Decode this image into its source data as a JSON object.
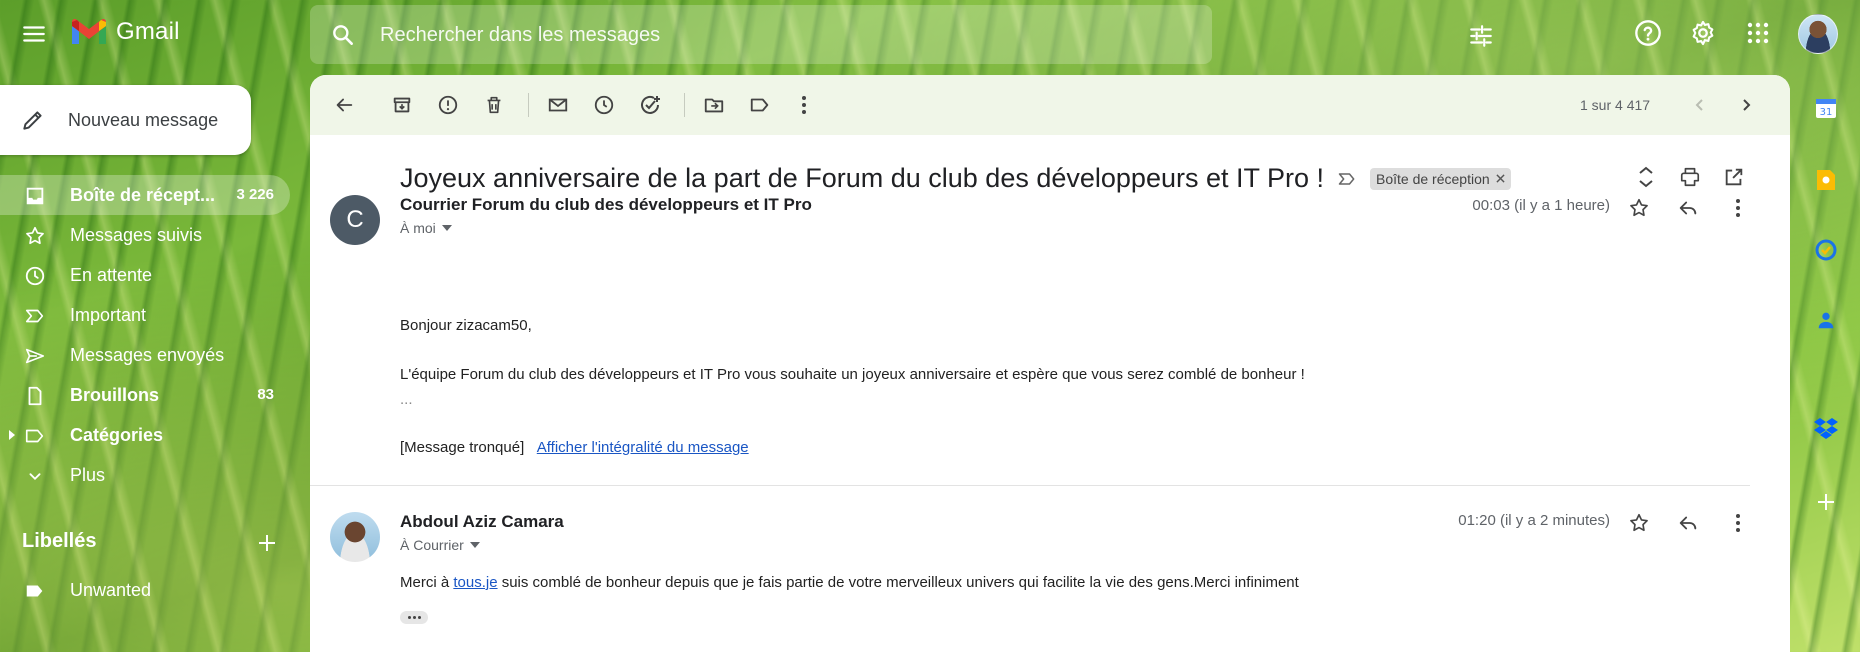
{
  "app": {
    "name": "Gmail"
  },
  "search": {
    "placeholder": "Rechercher dans les messages"
  },
  "compose": {
    "label": "Nouveau message"
  },
  "sidebar": {
    "items": [
      {
        "label": "Boîte de récept...",
        "count": "3 226"
      },
      {
        "label": "Messages suivis",
        "count": ""
      },
      {
        "label": "En attente",
        "count": ""
      },
      {
        "label": "Important",
        "count": ""
      },
      {
        "label": "Messages envoyés",
        "count": ""
      },
      {
        "label": "Brouillons",
        "count": "83"
      },
      {
        "label": "Catégories",
        "count": ""
      },
      {
        "label": "Plus",
        "count": ""
      }
    ],
    "labels_heading": "Libellés",
    "labels": [
      {
        "label": "Unwanted"
      }
    ]
  },
  "toolbar": {
    "pagination": "1 sur 4 417"
  },
  "thread": {
    "subject": "Joyeux anniversaire de la part de Forum du club des développeurs et IT Pro !",
    "chip": "Boîte de réception",
    "messages": [
      {
        "avatar_letter": "C",
        "sender": "Courrier Forum du club des développeurs et IT Pro",
        "to": "À moi",
        "time": "00:03 (il y a 1 heure)",
        "greeting": "Bonjour zizacam50,",
        "body": "L'équipe Forum du club des développeurs et IT Pro vous souhaite un joyeux anniversaire et espère que vous serez comblé de bonheur !",
        "ellipsis": "...",
        "truncated": "[Message tronqué]",
        "view_full": "Afficher l'intégralité du message"
      },
      {
        "sender": "Abdoul Aziz Camara",
        "to": "À Courrier",
        "time": "01:20 (il y a 2 minutes)",
        "body_before": "Merci à ",
        "body_link": "tous.je",
        "body_after": " suis comblé de bonheur depuis que je fais partie de votre merveilleux univers qui facilite la vie des gens.Merci infiniment"
      }
    ]
  },
  "colors": {
    "gmail_red": "#ea4335",
    "gmail_blue": "#4285f4",
    "gmail_green": "#34a853",
    "gmail_yellow": "#fbbc04",
    "avatar_grey": "#4d5a66",
    "link": "#1a56c4"
  }
}
